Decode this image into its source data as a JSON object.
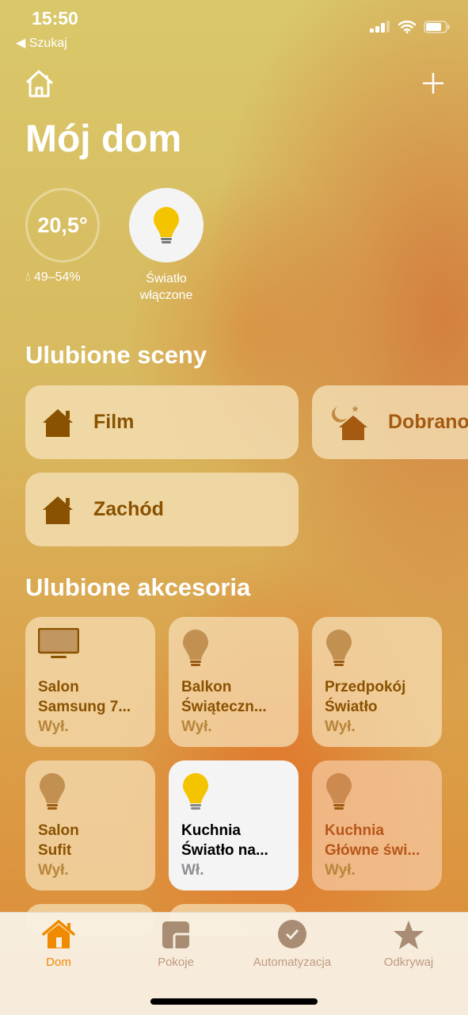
{
  "status": {
    "time": "15:50",
    "back": "◀ Szukaj"
  },
  "header": {
    "title": "Mój dom"
  },
  "summary": {
    "temperature": "20,5°",
    "humidity": "49–54%",
    "light_status": "Światło włączone"
  },
  "scenes": {
    "title": "Ulubione sceny",
    "items": [
      {
        "label": "Film"
      },
      {
        "label": "Dobranoc"
      },
      {
        "label": "Zachód"
      }
    ]
  },
  "accessories": {
    "title": "Ulubione akcesoria",
    "items": [
      {
        "room": "Salon",
        "name": "Samsung 7...",
        "state": "Wył.",
        "icon": "tv-icon"
      },
      {
        "room": "Balkon",
        "name": "Świąteczn...",
        "state": "Wył.",
        "icon": "lightbulb-icon"
      },
      {
        "room": "Przedpokój",
        "name": "Światło",
        "state": "Wył.",
        "icon": "lightbulb-icon"
      },
      {
        "room": "Salon",
        "name": "Sufit",
        "state": "Wył.",
        "icon": "lightbulb-icon"
      },
      {
        "room": "Kuchnia",
        "name": "Światło na...",
        "state": "Wł.",
        "icon": "lightbulb-icon"
      },
      {
        "room": "Kuchnia",
        "name": "Główne świ...",
        "state": "Wył.",
        "icon": "lightbulb-icon"
      }
    ]
  },
  "tabs": [
    {
      "label": "Dom"
    },
    {
      "label": "Pokoje"
    },
    {
      "label": "Automatyzacja"
    },
    {
      "label": "Odkrywaj"
    }
  ],
  "colors": {
    "accent": "#f08a00",
    "scene_text": "#8a5200"
  }
}
